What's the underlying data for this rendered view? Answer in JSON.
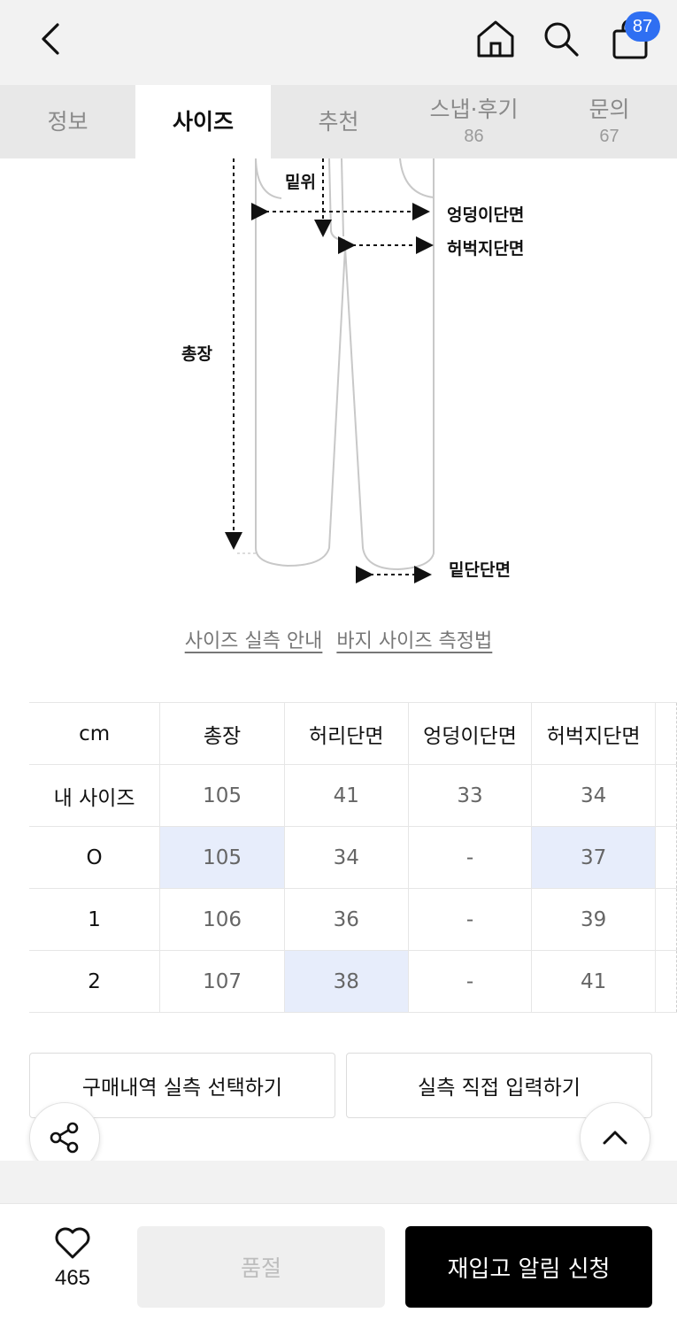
{
  "header": {
    "cart_badge": "87",
    "icons": [
      "back-arrow-icon",
      "home-icon",
      "search-icon",
      "shopping-bag-icon"
    ]
  },
  "tabs": [
    {
      "label": "정보",
      "count": ""
    },
    {
      "label": "사이즈",
      "count": "",
      "active": true
    },
    {
      "label": "추천",
      "count": ""
    },
    {
      "label": "스냅·후기",
      "count": "86"
    },
    {
      "label": "문의",
      "count": "67"
    }
  ],
  "diagram": {
    "labels": {
      "rise": "밑위",
      "hip": "엉덩이단면",
      "thigh": "허벅지단면",
      "length": "총장",
      "hem": "밑단단면"
    }
  },
  "links": {
    "size_guide": "사이즈 실측 안내",
    "pants_measure": "바지 사이즈 측정법"
  },
  "size_table": {
    "headers": [
      "cm",
      "총장",
      "허리단면",
      "엉덩이단면",
      "허벅지단면"
    ],
    "rows": [
      {
        "label": "내 사이즈",
        "values": [
          "105",
          "41",
          "33",
          "34"
        ]
      },
      {
        "label": "O",
        "values": [
          "105",
          "34",
          "-",
          "37"
        ]
      },
      {
        "label": "1",
        "values": [
          "106",
          "36",
          "-",
          "39"
        ]
      },
      {
        "label": "2",
        "values": [
          "107",
          "38",
          "-",
          "41"
        ]
      }
    ],
    "highlight_color": "#e7edfb"
  },
  "actions": {
    "purchase_history": "구매내역 실측 선택하기",
    "direct_input": "실측 직접 입력하기"
  },
  "floating": {
    "share_icon": "share-icon",
    "top_icon": "chevron-up-icon"
  },
  "bottom_bar": {
    "like_count": "465",
    "soldout_label": "품절",
    "restock_label": "재입고 알림 신청"
  },
  "colors": {
    "badge": "#2f6ff2",
    "primary_button": "#000000"
  }
}
